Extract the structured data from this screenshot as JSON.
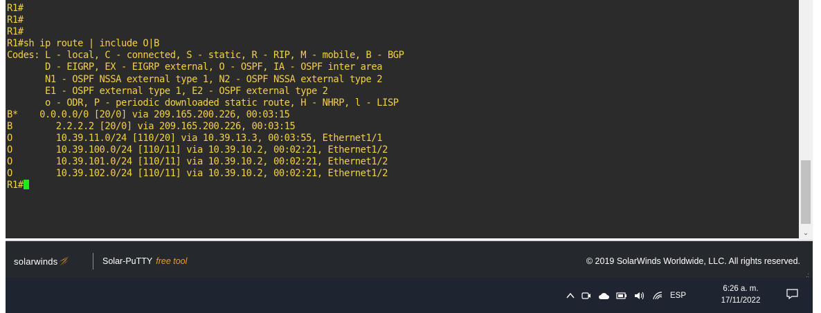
{
  "terminal": {
    "lines": [
      "R1#",
      "R1#",
      "R1#",
      "R1#sh ip route | include O|B",
      "Codes: L - local, C - connected, S - static, R - RIP, M - mobile, B - BGP",
      "       D - EIGRP, EX - EIGRP external, O - OSPF, IA - OSPF inter area",
      "       N1 - OSPF NSSA external type 1, N2 - OSPF NSSA external type 2",
      "       E1 - OSPF external type 1, E2 - OSPF external type 2",
      "       o - ODR, P - periodic downloaded static route, H - NHRP, l - LISP",
      "B*    0.0.0.0/0 [20/0] via 209.165.200.226, 00:03:15",
      "B        2.2.2.2 [20/0] via 209.165.200.226, 00:03:15",
      "O        10.39.11.0/24 [110/20] via 10.39.13.3, 00:03:55, Ethernet1/1",
      "O        10.39.100.0/24 [110/11] via 10.39.10.2, 00:02:21, Ethernet1/2",
      "O        10.39.101.0/24 [110/11] via 10.39.10.2, 00:02:21, Ethernet1/2",
      "O        10.39.102.0/24 [110/11] via 10.39.10.2, 00:02:21, Ethernet1/2"
    ],
    "prompt": "R1#",
    "text_color": "#f5d040",
    "cursor_color": "#1fe81f",
    "background": "#2b2b2b"
  },
  "scrollbar": {
    "down_arrow_icon": "chevron-down-icon"
  },
  "footer": {
    "brand": "solarwinds",
    "app_name": "Solar-PuTTY",
    "app_badge": "free tool",
    "copyright": "© 2019 SolarWinds Worldwide, LLC. All rights reserved.",
    "brand_accent": "#f39c12"
  },
  "taskbar": {
    "tray_icons": [
      "chevron-up-icon",
      "meet-now-icon",
      "onedrive-cloud-icon",
      "battery-icon",
      "speaker-icon",
      "wifi-icon"
    ],
    "language": "ESP",
    "time": "6:26 a. m.",
    "date": "17/11/2022",
    "notification_icon": "notification-icon"
  }
}
